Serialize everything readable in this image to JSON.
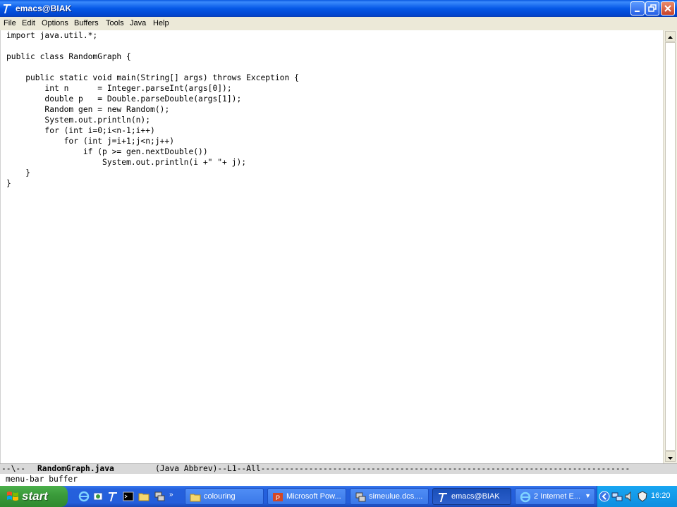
{
  "window": {
    "title": "emacs@BIAK"
  },
  "menubar": {
    "items": [
      "File",
      "Edit",
      "Options",
      "Buffers",
      "Tools",
      "Java",
      "Help"
    ]
  },
  "editor": {
    "lines": [
      "import java.util.*;",
      "",
      "public class RandomGraph {",
      "",
      "    public static void main(String[] args) throws Exception {",
      "        int n      = Integer.parseInt(args[0]);",
      "        double p   = Double.parseDouble(args[1]);",
      "        Random gen = new Random();",
      "        System.out.println(n);",
      "        for (int i=0;i<n-1;i++)",
      "            for (int j=i+1;j<n;j++)",
      "                if (p >= gen.nextDouble())",
      "                    System.out.println(i +\" \"+ j);",
      "    }",
      "}"
    ]
  },
  "modeline": {
    "prefix": "--\\--  ",
    "buffer_name": "RandomGraph.java",
    "mode_info": "(Java Abbrev)--L1--All-----------------------------------------------------------------------------"
  },
  "minibuffer": {
    "text": "menu-bar buffer"
  },
  "taskbar": {
    "start_label": "start",
    "tasks": [
      {
        "label": "colouring",
        "icon": "folder-icon"
      },
      {
        "label": "Microsoft Pow...",
        "icon": "powerpoint-icon"
      },
      {
        "label": "simeulue.dcs....",
        "icon": "putty-icon"
      },
      {
        "label": "emacs@BIAK",
        "icon": "emacs-icon",
        "active": true
      },
      {
        "label": "2 Internet E...",
        "icon": "internet-explorer-icon"
      }
    ],
    "clock": "16:20"
  },
  "colors": {
    "titlebar": "#0558e6",
    "menubar": "#ece9d8",
    "taskbar": "#245edb",
    "start_button": "#3a9a3a",
    "tray": "#0f8ee0",
    "modeline": "#d9d9d9"
  }
}
